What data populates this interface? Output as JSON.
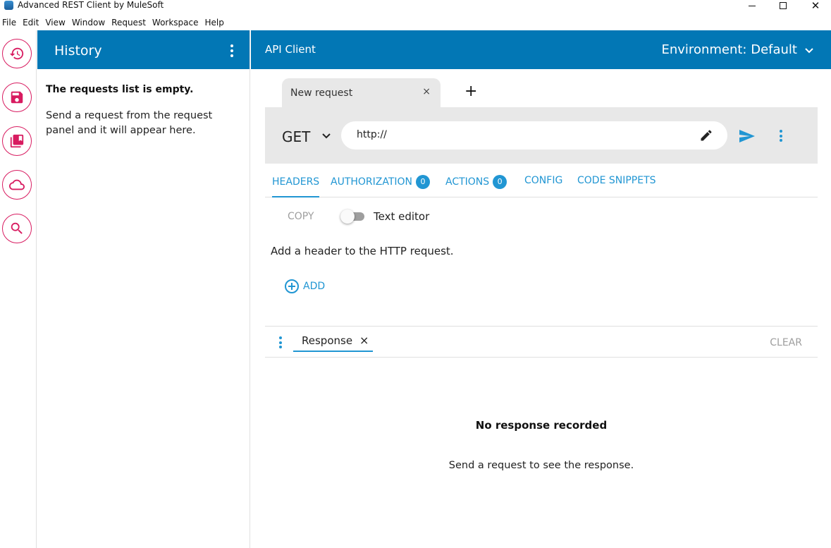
{
  "window": {
    "title": "Advanced REST Client by MuleSoft",
    "close_glyph": "✕"
  },
  "menubar": {
    "items": [
      "File",
      "Edit",
      "View",
      "Window",
      "Request",
      "Workspace",
      "Help"
    ]
  },
  "rail": {
    "icons": [
      "history-icon",
      "save-icon",
      "saved-requests-icon",
      "cloud-icon",
      "search-icon"
    ],
    "accent_color": "#d81b60"
  },
  "history": {
    "title": "History",
    "empty_title": "The requests list is empty.",
    "empty_text": "Send a request from the request panel and it will appear here."
  },
  "main": {
    "title": "API Client",
    "environment_label": "Environment: Default",
    "header_color": "#0277b5"
  },
  "request_tab": {
    "label": "New request",
    "close": "×",
    "add": "+"
  },
  "request": {
    "method": "GET",
    "url": "http://"
  },
  "sections": {
    "tabs": [
      {
        "label": "HEADERS",
        "badge": null
      },
      {
        "label": "AUTHORIZATION",
        "badge": "0"
      },
      {
        "label": "ACTIONS",
        "badge": "0"
      },
      {
        "label": "CONFIG",
        "badge": null
      },
      {
        "label": "CODE SNIPPETS",
        "badge": null
      }
    ],
    "active": "HEADERS",
    "accent_color": "#2196d3"
  },
  "headers_editor": {
    "copy_label": "COPY",
    "text_editor_label": "Text editor",
    "text_editor_enabled": false,
    "hint": "Add a header to the HTTP request.",
    "add_label": "ADD"
  },
  "response": {
    "tab_label": "Response",
    "tab_close": "×",
    "clear_label": "CLEAR",
    "empty_title": "No response recorded",
    "empty_text": "Send a request to see the response."
  }
}
